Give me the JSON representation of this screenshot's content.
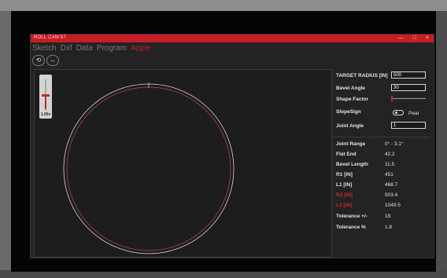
{
  "window": {
    "title": "ROLL CAM 57",
    "buttons": [
      "—",
      "□",
      "×"
    ]
  },
  "menu": {
    "items": [
      {
        "label": "Sketch",
        "active": false
      },
      {
        "label": "Dxf",
        "active": false
      },
      {
        "label": "Data",
        "active": false
      },
      {
        "label": "Program",
        "active": false
      },
      {
        "label": "Apple",
        "active": true
      }
    ]
  },
  "toolbar": {
    "icons": [
      "refresh-icon",
      "expand-icon"
    ],
    "glyphs": [
      "⟲",
      "↔"
    ]
  },
  "zoom_slider": {
    "label": "1.00x",
    "level": 0.45
  },
  "params": {
    "target_radius_label": "TARGET RADIUS [IN]",
    "target_radius_value": "500",
    "bevel_angle_label": "Bevel Angle",
    "bevel_angle_value": "30",
    "shape_factor_label": "Shape Factor",
    "shape_factor_level": 0.0,
    "slope_sign_label": "SlopeSign",
    "slope_sign_toggle_label": "Pear",
    "joint_angle_label": "Joint Angle",
    "joint_angle_value": "1"
  },
  "results": [
    {
      "label": "Joint Range",
      "value": "0° - 3.1°",
      "highlight": false
    },
    {
      "label": "Flat End",
      "value": "42.2",
      "highlight": false
    },
    {
      "label": "Bevel Length",
      "value": "11.5",
      "highlight": false
    },
    {
      "label": "R1 [IN]",
      "value": "451",
      "highlight": false
    },
    {
      "label": "L1 [IN]",
      "value": "468.7",
      "highlight": false
    },
    {
      "label": "R2 [IN]",
      "value": "503.4",
      "highlight": true
    },
    {
      "label": "L2 [IN]",
      "value": "1049.5",
      "highlight": true
    },
    {
      "label": "Tolerance +/-",
      "value": "19",
      "highlight": false
    },
    {
      "label": "Tolerance %",
      "value": "1.8",
      "highlight": false
    }
  ],
  "colors": {
    "accent": "#c81d25",
    "circle_outer": "#d8d8d8",
    "circle_inner": "#c44a4a"
  }
}
